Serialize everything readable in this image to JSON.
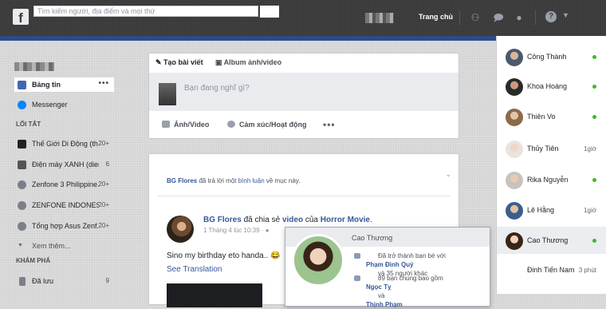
{
  "topbar": {
    "logo": "f",
    "search_placeholder": "Tìm kiếm người, địa điểm và mọi thứ",
    "home_label": "Trang chủ",
    "icons": [
      "friends-icon",
      "messenger-icon",
      "globe-icon",
      "help-icon",
      "caret-down-icon"
    ]
  },
  "left_nav": {
    "pinned": [
      {
        "label": "Bảng tin",
        "more": "•••",
        "icon": "news-feed-icon"
      },
      {
        "label": "Messenger",
        "icon": "messenger-icon"
      }
    ],
    "shortcuts_heading": "LỐI TẮT",
    "shortcuts": [
      {
        "label": "Thế Giới Di Động (th...",
        "count": "20+"
      },
      {
        "label": "Điện máy XANH (dien...",
        "count": "6"
      },
      {
        "label": "Zenfone 3 Philippine...",
        "count": "20+"
      },
      {
        "label": "ZENFONE INDONESI...",
        "count": "20+"
      },
      {
        "label": "Tổng hợp Asus Zenf...",
        "count": "20+"
      }
    ],
    "see_more": "Xem thêm...",
    "explore_heading": "KHÁM PHÁ",
    "explore": [
      {
        "label": "Đã lưu",
        "count": "9"
      }
    ]
  },
  "composer": {
    "tab_post": "Tạo bài viết",
    "tab_album": "Album ảnh/video",
    "placeholder": "Bạn đang nghĩ gì?",
    "action_photo": "Ảnh/Video",
    "action_feeling": "Cảm xúc/Hoạt động",
    "action_more": "•••"
  },
  "post": {
    "activity_actor": "BG Flores",
    "activity_mid": " đã trả lời một ",
    "activity_link": "bình luận",
    "activity_end": " về mục này.",
    "author": "BG Flores",
    "shared_mid": " đã chia sẻ ",
    "shared_link": "video",
    "shared_of": " của ",
    "shared_page": "Horror Movie",
    "shared_end": ".",
    "meta": "1 Tháng 4 lúc 10:39 · ",
    "text": "Sino my birthday eto handa.. 😂",
    "translation": "See Translation"
  },
  "hover_card": {
    "name": "Cao Thương",
    "line1_pre": "Đã trở thành bạn bè với ",
    "line1_name": "Phạm Đình Quý",
    "line1_post": " và 35 người khác",
    "line2_pre": "89 bạn chung bao gồm ",
    "line2_name1": "Ngọc Tỵ",
    "line2_mid": " và ",
    "line2_name2": "Thịnh Phạm"
  },
  "chat": [
    {
      "name": "Công Thành",
      "status": "online",
      "time": ""
    },
    {
      "name": "Khoa Hoàng",
      "status": "online",
      "time": ""
    },
    {
      "name": "Thiên Vo",
      "status": "online",
      "time": ""
    },
    {
      "name": "Thủy Tiên",
      "status": "idle",
      "time": "1giờ"
    },
    {
      "name": "Rika Nguyễn",
      "status": "online",
      "time": ""
    },
    {
      "name": "Lê Hằng",
      "status": "idle",
      "time": "1giờ"
    },
    {
      "name": "Cao Thương",
      "status": "online",
      "time": ""
    },
    {
      "name": "Đinh Tiến Nam",
      "status": "idle",
      "time": "3 phút"
    }
  ],
  "colors": {
    "accent": "#365899",
    "online": "#42b72a",
    "topbar": "#3a3a3a"
  }
}
